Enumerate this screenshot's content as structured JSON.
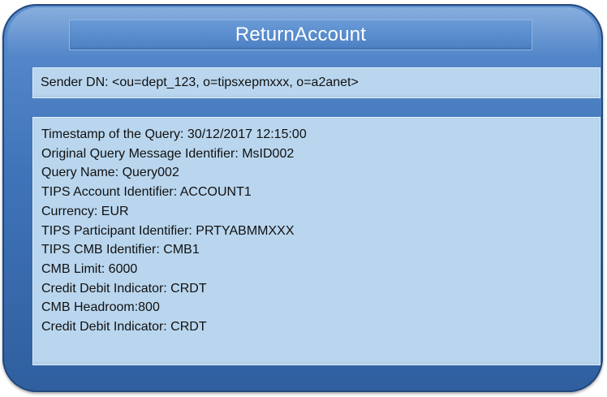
{
  "title": "ReturnAccount",
  "sender": "Sender DN: <ou=dept_123, o=tipsxepmxxx, o=a2anet>",
  "details": [
    "Timestamp of the Query: 30/12/2017 12:15:00",
    "Original Query Message Identifier: MsID002",
    "Query Name: Query002",
    "TIPS Account Identifier: ACCOUNT1",
    "Currency: EUR",
    "TIPS Participant Identifier: PRTYABMMXXX",
    "TIPS CMB Identifier: CMB1",
    "CMB Limit: 6000",
    "Credit Debit Indicator: CRDT",
    "CMB Headroom:800",
    "Credit Debit Indicator: CRDT"
  ],
  "colors": {
    "frame": "#3f73b8",
    "title_bar": "#4a7fc2",
    "panel": "#b9d6ee",
    "text": "#111111",
    "title_text": "#ffffff"
  }
}
